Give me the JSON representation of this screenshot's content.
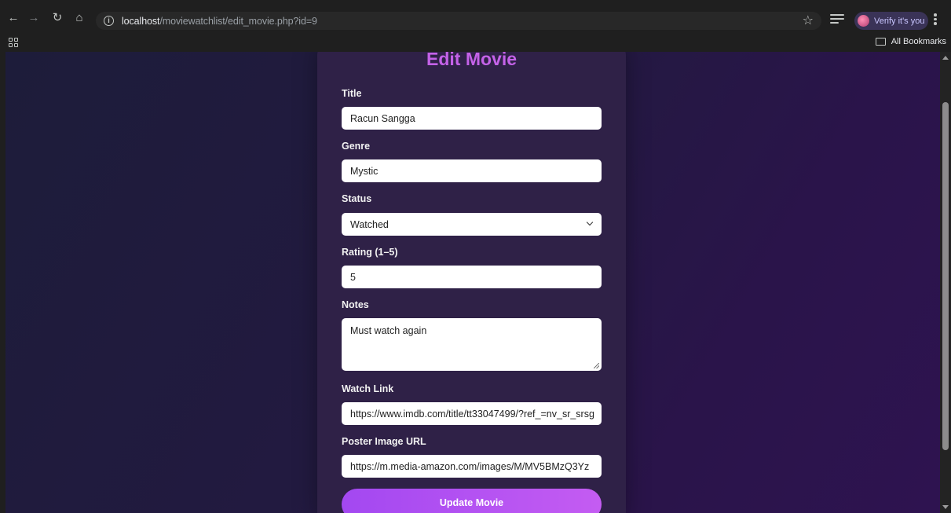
{
  "browser": {
    "url_host": "localhost",
    "url_path": "/moviewatchlist/edit_movie.php?id=9",
    "profile_label": "Verify it's you",
    "bookmarks_label": "All Bookmarks",
    "icons": [
      "back-icon",
      "forward-icon",
      "reload-icon",
      "home-icon",
      "site-info-icon",
      "star-icon",
      "media-controls-icon",
      "menu-icon",
      "apps-icon",
      "folder-icon"
    ]
  },
  "form": {
    "heading": "Edit Movie",
    "title_label": "Title",
    "title_value": "Racun Sangga",
    "genre_label": "Genre",
    "genre_value": "Mystic",
    "status_label": "Status",
    "status_value": "Watched",
    "rating_label": "Rating (1–5)",
    "rating_value": "5",
    "notes_label": "Notes",
    "notes_value": "Must watch again",
    "watch_link_label": "Watch Link",
    "watch_link_value": "https://www.imdb.com/title/tt33047499/?ref_=nv_sr_srsg",
    "poster_label": "Poster Image URL",
    "poster_value": "https://m.media-amazon.com/images/M/MV5BMzQ3Yz",
    "submit_label": "Update Movie"
  },
  "colors": {
    "heading": "#c462e8",
    "card": "#2f2147",
    "button_start": "#a348f1",
    "button_end": "#c45cf2"
  }
}
